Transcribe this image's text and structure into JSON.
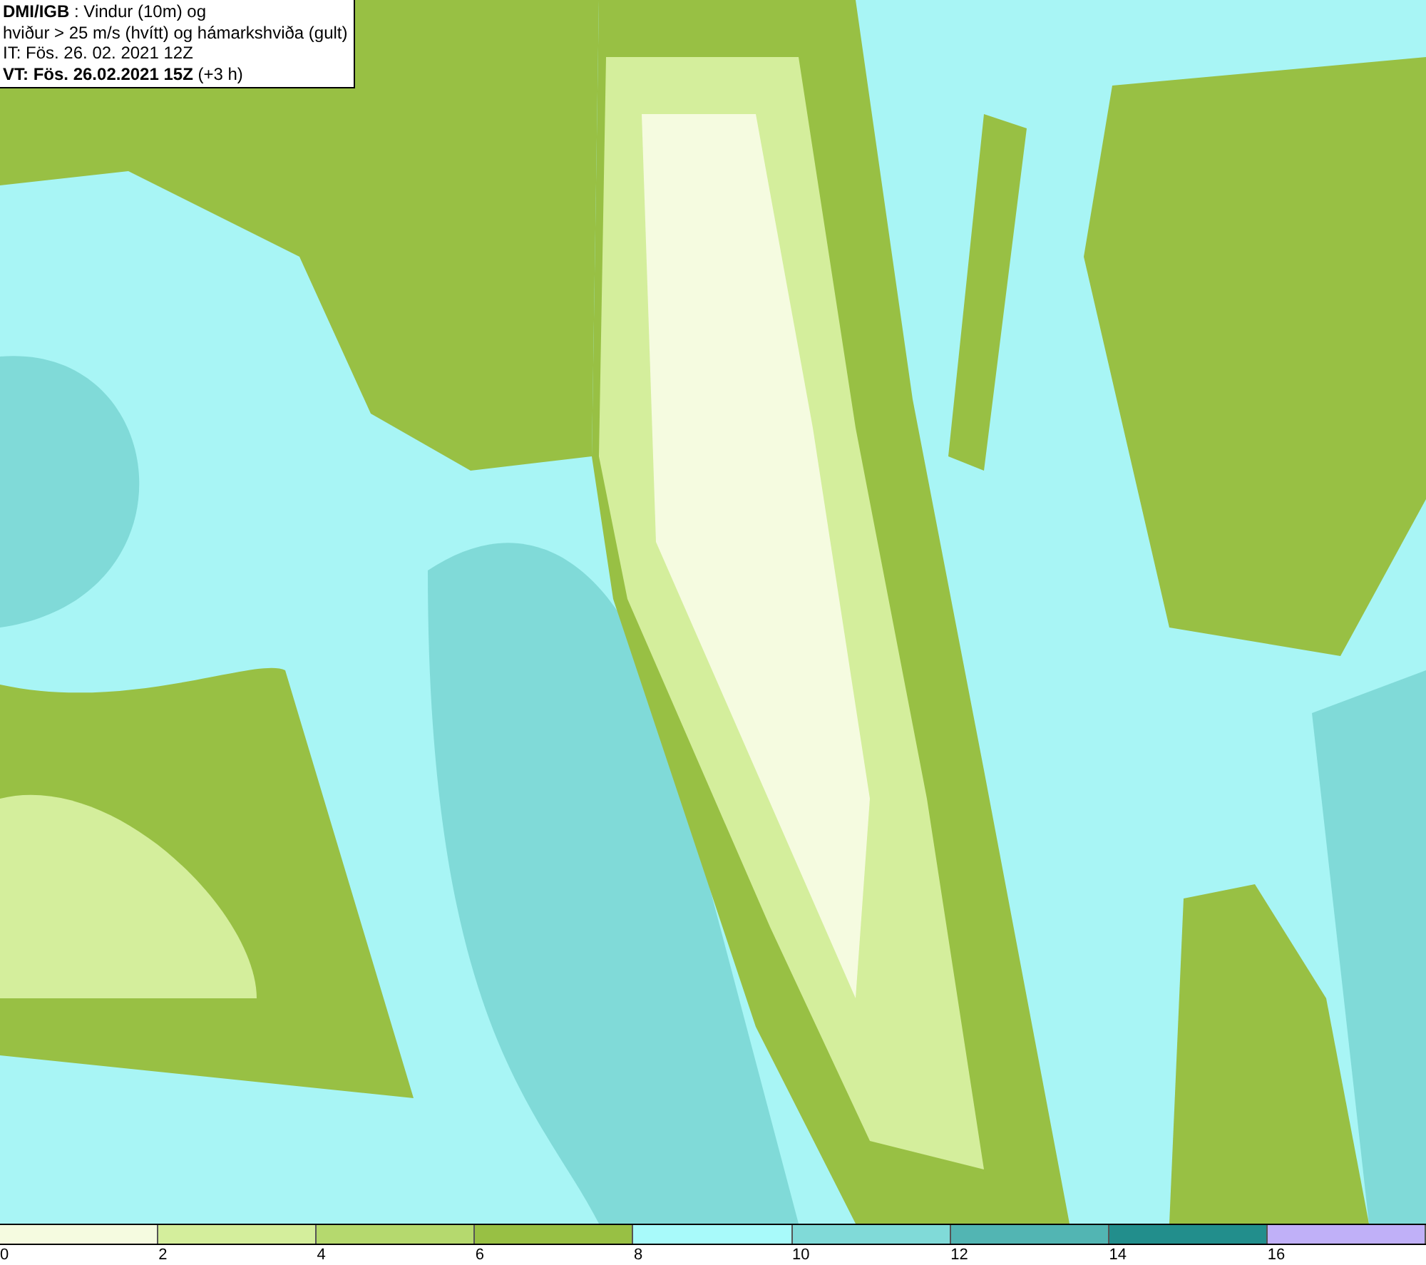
{
  "header": {
    "lines": [
      "**DMI/IGB** : Vindur (10m) og",
      "hviður > 25 m/s (hvítt) og hámarkshviða (gult)",
      "IT: Fös. 26. 02. 2021 12Z",
      "**VT: Fös. 26.02.2021 15Z** (+3 h)"
    ]
  },
  "legend": {
    "bins": [
      {
        "color": "#f5fbe0"
      },
      {
        "color": "#d4ee9c"
      },
      {
        "color": "#b5d96e"
      },
      {
        "color": "#98c044"
      },
      {
        "color": "#a8fafa"
      },
      {
        "color": "#80dad8"
      },
      {
        "color": "#52b5b3"
      },
      {
        "color": "#228e8c"
      },
      {
        "color": "#c0b0f8"
      }
    ],
    "ticks": [
      "0",
      "2",
      "4",
      "6",
      "8",
      "10",
      "12",
      "14",
      "16"
    ]
  }
}
